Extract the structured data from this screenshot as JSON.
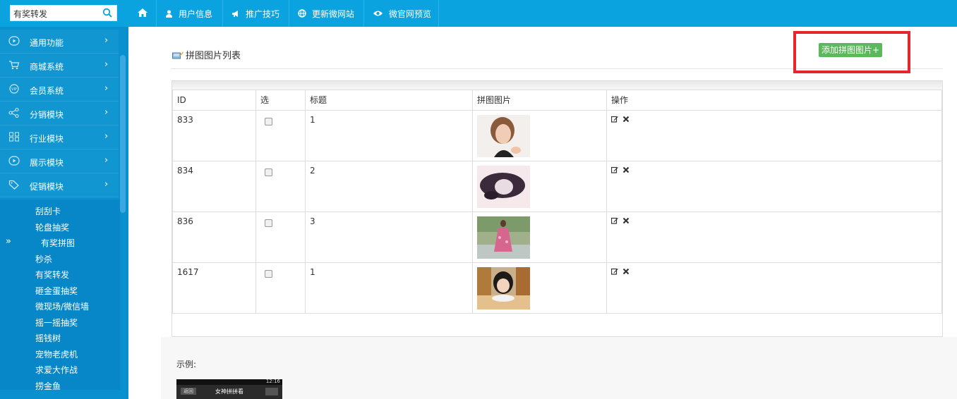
{
  "search": {
    "value": "有奖转发"
  },
  "topnav": [
    {
      "label": "",
      "icon": "home-icon"
    },
    {
      "label": "用户信息",
      "icon": "user-icon"
    },
    {
      "label": "推广技巧",
      "icon": "megaphone-icon"
    },
    {
      "label": "更新微网站",
      "icon": "globe-icon"
    },
    {
      "label": "微官网预览",
      "icon": "eye-icon"
    }
  ],
  "sidebar": {
    "menus": [
      {
        "label": "通用功能",
        "icon": "play-circle-icon"
      },
      {
        "label": "商城系统",
        "icon": "cart-icon"
      },
      {
        "label": "会员系统",
        "icon": "vip-icon"
      },
      {
        "label": "分销模块",
        "icon": "share-icon"
      },
      {
        "label": "行业模块",
        "icon": "grid-icon"
      },
      {
        "label": "展示模块",
        "icon": "play-circle-icon"
      },
      {
        "label": "促销模块",
        "icon": "tag-icon"
      }
    ],
    "submenu": [
      "刮刮卡",
      "轮盘抽奖",
      "有奖拼图",
      "秒杀",
      "有奖转发",
      "砸金蛋抽奖",
      "微现场/微信墙",
      "摇一摇抽奖",
      "摇钱树",
      "宠物老虎机",
      "求爱大作战",
      "捞金鱼"
    ],
    "active_marker": "»"
  },
  "panel": {
    "title": "拼图图片列表",
    "add_button": "添加拼图图片+"
  },
  "table": {
    "headers": [
      "ID",
      "选",
      "标题",
      "拼图图片",
      "操作"
    ],
    "rows": [
      {
        "id": "833",
        "title": "1"
      },
      {
        "id": "834",
        "title": "2"
      },
      {
        "id": "836",
        "title": "3"
      },
      {
        "id": "1617",
        "title": "1"
      }
    ]
  },
  "example": {
    "label": "示例:",
    "phone_title": "女神拼拼看",
    "phone_back": "返回",
    "phone_time": "12:16"
  },
  "colors": {
    "topbar": "#0aa3e0",
    "sidebar": "#0a8fcf",
    "add_button": "#5cb85c",
    "highlight": "#e5262d"
  }
}
